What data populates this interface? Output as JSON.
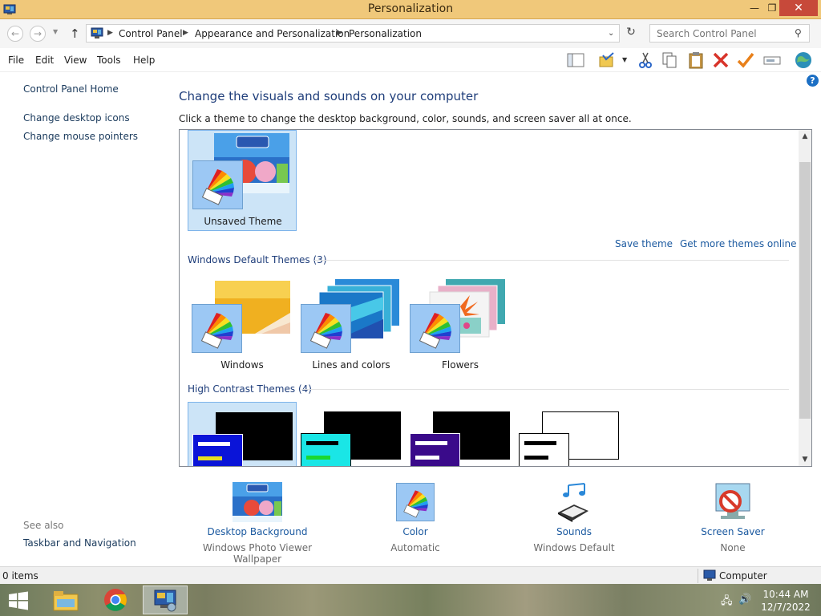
{
  "window": {
    "title": "Personalization"
  },
  "address": {
    "crumbs": [
      "Control Panel",
      "Appearance and Personalization",
      "Personalization"
    ],
    "search_placeholder": "Search Control Panel"
  },
  "menu": [
    "File",
    "Edit",
    "View",
    "Tools",
    "Help"
  ],
  "sidebar": {
    "home": "Control Panel Home",
    "links": [
      "Change desktop icons",
      "Change mouse pointers"
    ],
    "see_also_label": "See also",
    "see_also": [
      "Taskbar and Navigation"
    ]
  },
  "main": {
    "heading": "Change the visuals and sounds on your computer",
    "subtext": "Click a theme to change the desktop background, color, sounds, and screen saver all at once."
  },
  "themes": {
    "my_theme": "Unsaved Theme",
    "save_link": "Save theme",
    "more_link": "Get more themes online",
    "default_group": "Windows Default Themes (3)",
    "default_items": [
      "Windows",
      "Lines and colors",
      "Flowers"
    ],
    "contrast_group": "High Contrast Themes (4)",
    "contrast_colors": [
      "#0a14d8",
      "#1ae6e6",
      "#3a0a8a",
      "#ffffff"
    ]
  },
  "settings": [
    {
      "title": "Desktop Background",
      "value": "Windows Photo Viewer Wallpaper"
    },
    {
      "title": "Color",
      "value": "Automatic"
    },
    {
      "title": "Sounds",
      "value": "Windows Default"
    },
    {
      "title": "Screen Saver",
      "value": "None"
    }
  ],
  "status": {
    "items": "0 items",
    "location": "Computer"
  },
  "clock": {
    "time": "10:44 AM",
    "date": "12/7/2022"
  },
  "icons": {
    "title_app": "control-panel-icon",
    "close": "✕",
    "restore": "❐",
    "minimize": "—"
  }
}
